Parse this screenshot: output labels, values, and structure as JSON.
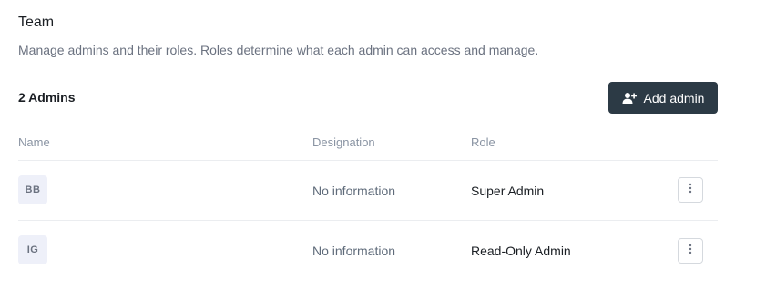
{
  "header": {
    "title": "Team",
    "subtitle": "Manage admins and their roles. Roles determine what each admin can access and manage."
  },
  "toolbar": {
    "count_label": "2 Admins",
    "add_button_label": "Add admin",
    "add_button_icon": "user-plus-icon"
  },
  "table": {
    "columns": [
      "Name",
      "Designation",
      "Role"
    ],
    "rows": [
      {
        "initials": "BB",
        "designation": "No information",
        "role": "Super Admin"
      },
      {
        "initials": "IG",
        "designation": "No information",
        "role": "Read-Only Admin"
      }
    ]
  },
  "colors": {
    "primary_button": "#2c3a45",
    "avatar_bg": "#eef0f9",
    "muted_text": "#6b7280"
  }
}
